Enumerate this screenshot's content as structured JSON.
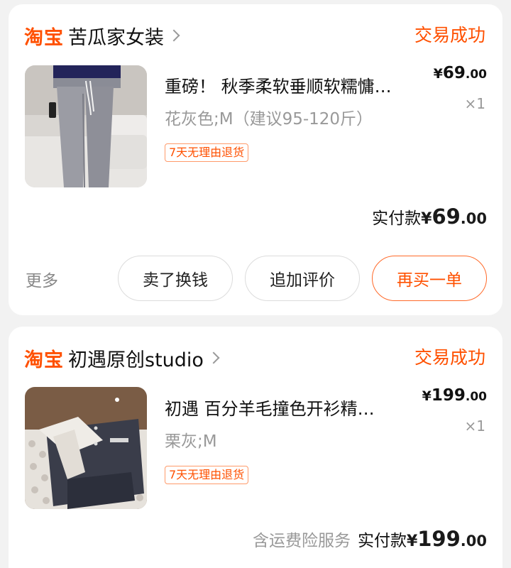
{
  "orders": [
    {
      "platform": "淘宝",
      "shop_name": "苦瓜家女装",
      "status": "交易成功",
      "item": {
        "title": "重磅！ 秋季柔软垂顺软糯慵…",
        "sku": "花灰色;M（建议95-120斤）",
        "tag": "7天无理由退货",
        "price_yen": "¥",
        "price_int": "69",
        "price_dec": ".00",
        "qty": "×1"
      },
      "paid_label": "实付款",
      "paid_yen": "¥",
      "paid_int": "69",
      "paid_dec": ".00",
      "more_label": "更多",
      "buttons": {
        "sell": "卖了换钱",
        "review": "追加评价",
        "rebuy": "再买一单"
      }
    },
    {
      "platform": "淘宝",
      "shop_name": "初遇原创studio",
      "status": "交易成功",
      "item": {
        "title": "初遇 百分羊毛撞色开衫精…",
        "sku": "栗灰;M",
        "tag": "7天无理由退货",
        "price_yen": "¥",
        "price_int": "199",
        "price_dec": ".00",
        "qty": "×1"
      },
      "insurance_label": "含运费险服务",
      "paid_label": "实付款",
      "paid_yen": "¥",
      "paid_int": "199",
      "paid_dec": ".00"
    }
  ],
  "colors": {
    "accent": "#ff5000",
    "muted_text": "#999999",
    "background": "#f2f2f2"
  },
  "icons": {
    "shop_chevron": "chevron-right-icon"
  }
}
